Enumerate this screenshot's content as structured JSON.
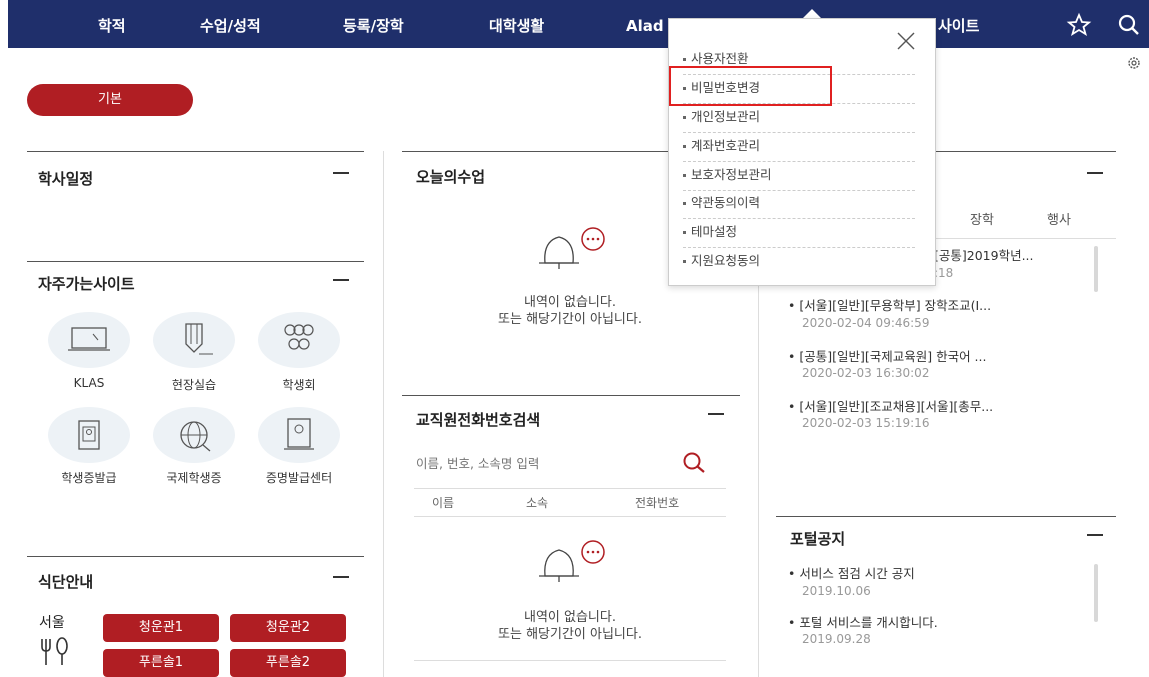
{
  "nav": {
    "items": [
      "학적",
      "수업/성적",
      "등록/장학",
      "대학생활",
      "Alad"
    ],
    "site_item": "사이트",
    "icons": [
      "star-icon",
      "search-icon"
    ]
  },
  "basic_button": "기본",
  "schedule": {
    "title": "학사일정"
  },
  "sites": {
    "title": "자주가는사이트",
    "items": [
      {
        "label": "KLAS",
        "icon": "monitor-icon"
      },
      {
        "label": "현장실습",
        "icon": "pencil-icon"
      },
      {
        "label": "학생회",
        "icon": "people-icon"
      },
      {
        "label": "학생증발급",
        "icon": "id-card-icon"
      },
      {
        "label": "국제학생증",
        "icon": "globe-icon"
      },
      {
        "label": "증명발급센터",
        "icon": "certificate-icon"
      }
    ]
  },
  "cafeteria": {
    "title": "식단안내",
    "location": "서울",
    "buttons": [
      "청운관1",
      "청운관2",
      "푸른솔1",
      "푸른솔2"
    ]
  },
  "today_class": {
    "title": "오늘의수업",
    "empty_line1": "내역이 없습니다.",
    "empty_line2": "또는 해당기간이 아닙니다."
  },
  "phone_search": {
    "title": "교직원전화번호검색",
    "placeholder": "이름, 번호, 소속명 입력",
    "columns": [
      "이름",
      "소속",
      "전화번호"
    ],
    "empty_line1": "내역이 없습니다.",
    "empty_line2": "또는 해당기간이 아닙니다."
  },
  "notices": {
    "tabs": [
      "장학",
      "행사"
    ],
    "items": [
      {
        "title": "[공통]2019학년...",
        "date": ":18"
      },
      {
        "title": "• [서울][일반][무용학부] 장학조교(I...",
        "date": "2020-02-04 09:46:59"
      },
      {
        "title": "• [공통][일반][국제교육원] 한국어 ...",
        "date": "2020-02-03 16:30:02"
      },
      {
        "title": "• [서울][일반][조교채용][서울][총무...",
        "date": "2020-02-03 15:19:16"
      }
    ]
  },
  "portal": {
    "title": "포털공지",
    "items": [
      {
        "title": "• 서비스 점검 시간 공지",
        "date": "2019.10.06"
      },
      {
        "title": "• 포털 서비스를 개시합니다.",
        "date": "2019.09.28"
      }
    ]
  },
  "dropdown": {
    "items": [
      "사용자전환",
      "비밀번호변경",
      "개인정보관리",
      "계좌번호관리",
      "보호자정보관리",
      "약관동의이력",
      "테마설정",
      "지원요청동의"
    ],
    "highlighted_index": 1
  }
}
